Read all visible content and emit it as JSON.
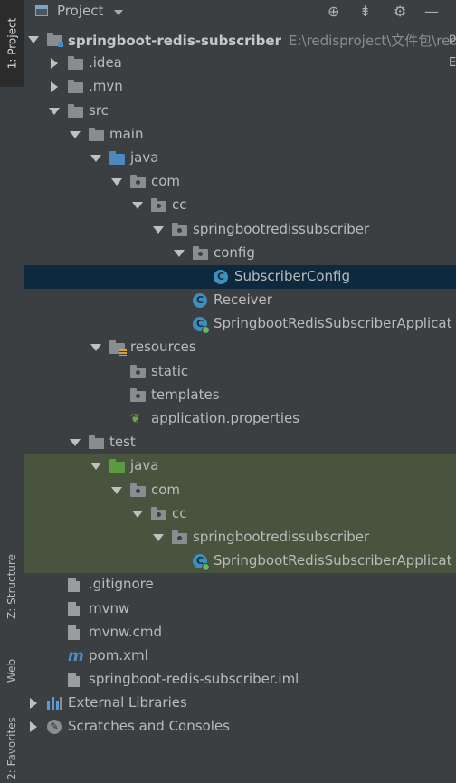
{
  "side_tabs": [
    {
      "label": "1: Project",
      "active": true
    },
    {
      "label": "Z: Structure",
      "active": false
    },
    {
      "label": "Web",
      "active": false
    },
    {
      "label": "2: Favorites",
      "active": false
    }
  ],
  "header": {
    "title": "Project",
    "icons": [
      "crosshair-icon",
      "collapse-icon",
      "gear-icon",
      "minimize-icon"
    ]
  },
  "tree": [
    {
      "label": "springboot-redis-subscriber",
      "path": "E:\\redisproject\\文件包\\redis",
      "icon": "module-folder",
      "depth": 0,
      "expanded": true,
      "bold": true
    },
    {
      "label": ".idea",
      "icon": "folder",
      "depth": 1,
      "expanded": false
    },
    {
      "label": ".mvn",
      "icon": "folder",
      "depth": 1,
      "expanded": false
    },
    {
      "label": "src",
      "icon": "folder",
      "depth": 1,
      "expanded": true
    },
    {
      "label": "main",
      "icon": "folder",
      "depth": 2,
      "expanded": true
    },
    {
      "label": "java",
      "icon": "source-folder",
      "depth": 3,
      "expanded": true
    },
    {
      "label": "com",
      "icon": "package",
      "depth": 4,
      "expanded": true
    },
    {
      "label": "cc",
      "icon": "package",
      "depth": 5,
      "expanded": true
    },
    {
      "label": "springbootredissubscriber",
      "icon": "package",
      "depth": 6,
      "expanded": true
    },
    {
      "label": "config",
      "icon": "package",
      "depth": 7,
      "expanded": true
    },
    {
      "label": "SubscriberConfig",
      "icon": "class",
      "depth": 8,
      "selected": true
    },
    {
      "label": "Receiver",
      "icon": "class",
      "depth": 7
    },
    {
      "label": "SpringbootRedisSubscriberApplicat",
      "icon": "class-run",
      "depth": 7
    },
    {
      "label": "resources",
      "icon": "resources-folder",
      "depth": 3,
      "expanded": true
    },
    {
      "label": "static",
      "icon": "package",
      "depth": 4
    },
    {
      "label": "templates",
      "icon": "package",
      "depth": 4
    },
    {
      "label": "application.properties",
      "icon": "spring-leaf",
      "depth": 4
    },
    {
      "label": "test",
      "icon": "folder",
      "depth": 2,
      "expanded": true
    },
    {
      "label": "java",
      "icon": "test-folder",
      "depth": 3,
      "expanded": true,
      "test": true
    },
    {
      "label": "com",
      "icon": "package",
      "depth": 4,
      "expanded": true,
      "test": true
    },
    {
      "label": "cc",
      "icon": "package",
      "depth": 5,
      "expanded": true,
      "test": true
    },
    {
      "label": "springbootredissubscriber",
      "icon": "package",
      "depth": 6,
      "expanded": true,
      "test": true
    },
    {
      "label": "SpringbootRedisSubscriberApplicat",
      "icon": "class-run",
      "depth": 7,
      "test": true
    },
    {
      "label": ".gitignore",
      "icon": "file",
      "depth": 1
    },
    {
      "label": "mvnw",
      "icon": "file",
      "depth": 1
    },
    {
      "label": "mvnw.cmd",
      "icon": "file",
      "depth": 1
    },
    {
      "label": "pom.xml",
      "icon": "maven",
      "depth": 1
    },
    {
      "label": "springboot-redis-subscriber.iml",
      "icon": "file",
      "depth": 1
    },
    {
      "label": "External Libraries",
      "icon": "libraries",
      "depth": 0,
      "expanded": false
    },
    {
      "label": "Scratches and Consoles",
      "icon": "scratches",
      "depth": 0,
      "expanded": false
    }
  ],
  "right_peek": [
    "p",
    "E"
  ],
  "colors": {
    "background": "#3c3f41",
    "selection": "#0d293e",
    "test_highlight": "#49543f",
    "source_folder": "#4b8ac0",
    "test_folder": "#5b9a3e"
  }
}
